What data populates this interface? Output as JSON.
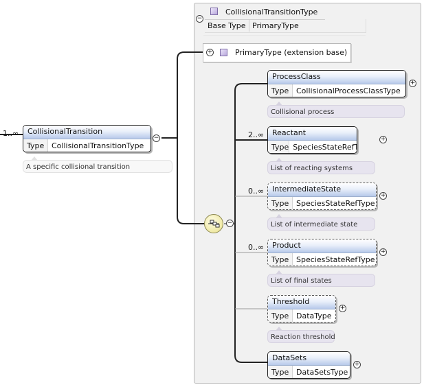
{
  "root_element": {
    "multiplicity": "1..∞",
    "name": "CollisionalTransition",
    "type_key": "Type",
    "type_value": "CollisionalTransitionType",
    "documentation": "A specific collisional transition"
  },
  "complex_type": {
    "name": "CollisionalTransitionType",
    "base_type_key": "Base Type",
    "base_type_value": "PrimaryType",
    "extension_label": "PrimaryType (extension base)"
  },
  "children": [
    {
      "name": "ProcessClass",
      "multiplicity": "",
      "type_key": "Type",
      "type_value": "CollisionalProcessClassType",
      "documentation": "Collisional process"
    },
    {
      "name": "Reactant",
      "multiplicity": "2..∞",
      "type_key": "Type",
      "type_value": "SpeciesStateRefType",
      "documentation": "List of reacting systems"
    },
    {
      "name": "IntermediateState",
      "multiplicity": "0..∞",
      "type_key": "Type",
      "type_value": "SpeciesStateRefType",
      "documentation": "List of intermediate state"
    },
    {
      "name": "Product",
      "multiplicity": "0..∞",
      "type_key": "Type",
      "type_value": "SpeciesStateRefType",
      "documentation": "List of final states"
    },
    {
      "name": "Threshold",
      "multiplicity": "",
      "type_key": "Type",
      "type_value": "DataType",
      "documentation": "Reaction threshold"
    },
    {
      "name": "DataSets",
      "multiplicity": "",
      "type_key": "Type",
      "type_value": "DataSetsType",
      "documentation": ""
    }
  ],
  "icons": {
    "expand": "+",
    "collapse": "−"
  },
  "colors": {
    "header_gradient_bottom": "#b7c9ea",
    "annotation_bg": "#e7e4ef",
    "group_bg": "#f1f1f1",
    "sequence_fill": "#efe9a6"
  }
}
